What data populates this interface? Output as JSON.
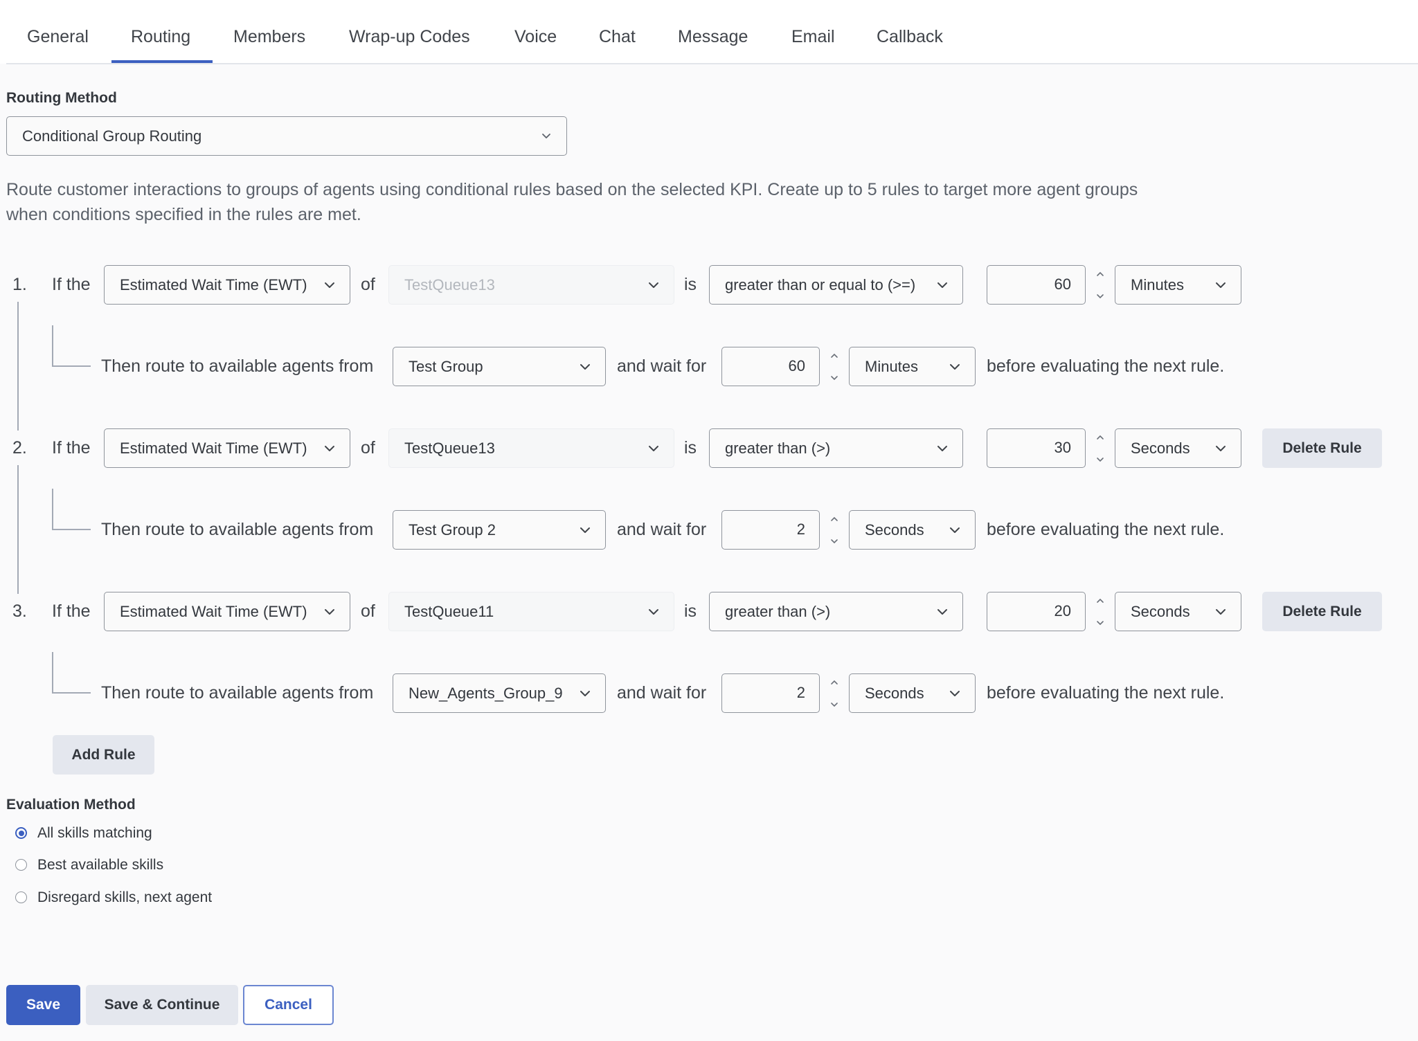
{
  "tabs": [
    {
      "label": "General",
      "active": false
    },
    {
      "label": "Routing",
      "active": true
    },
    {
      "label": "Members",
      "active": false
    },
    {
      "label": "Wrap-up Codes",
      "active": false
    },
    {
      "label": "Voice",
      "active": false
    },
    {
      "label": "Chat",
      "active": false
    },
    {
      "label": "Message",
      "active": false
    },
    {
      "label": "Email",
      "active": false
    },
    {
      "label": "Callback",
      "active": false
    }
  ],
  "routing_method": {
    "label": "Routing Method",
    "selected": "Conditional Group Routing",
    "description": "Route customer interactions to groups of agents using conditional rules based on the selected KPI. Create up to 5 rules to target more agent groups when conditions specified in the rules are met."
  },
  "rule_text": {
    "if_the": "If the",
    "of": "of",
    "is": "is",
    "then_route": "Then route to available agents from",
    "and_wait_for": "and wait for",
    "before_next": "before evaluating the next rule.",
    "delete_rule": "Delete Rule"
  },
  "rules": [
    {
      "number": "1.",
      "kpi": "Estimated Wait Time (EWT)",
      "queue": "TestQueue13",
      "queue_disabled": true,
      "operator": "greater than or equal to (>=)",
      "value": "60",
      "unit": "Minutes",
      "group": "Test Group",
      "wait_value": "60",
      "wait_unit": "Minutes",
      "deletable": false
    },
    {
      "number": "2.",
      "kpi": "Estimated Wait Time (EWT)",
      "queue": "TestQueue13",
      "queue_disabled": false,
      "operator": "greater than (>)",
      "value": "30",
      "unit": "Seconds",
      "group": "Test Group 2",
      "wait_value": "2",
      "wait_unit": "Seconds",
      "deletable": true
    },
    {
      "number": "3.",
      "kpi": "Estimated Wait Time (EWT)",
      "queue": "TestQueue11",
      "queue_disabled": false,
      "operator": "greater than (>)",
      "value": "20",
      "unit": "Seconds",
      "group": "New_Agents_Group_9",
      "wait_value": "2",
      "wait_unit": "Seconds",
      "deletable": true
    }
  ],
  "add_rule_label": "Add Rule",
  "evaluation": {
    "label": "Evaluation Method",
    "options": [
      {
        "label": "All skills matching",
        "checked": true
      },
      {
        "label": "Best available skills",
        "checked": false
      },
      {
        "label": "Disregard skills, next agent",
        "checked": false
      }
    ]
  },
  "footer": {
    "save": "Save",
    "save_continue": "Save & Continue",
    "cancel": "Cancel"
  },
  "colors": {
    "accent": "#3b5fc0",
    "secondary_button": "#e4e7ee",
    "border": "#8f949c"
  }
}
